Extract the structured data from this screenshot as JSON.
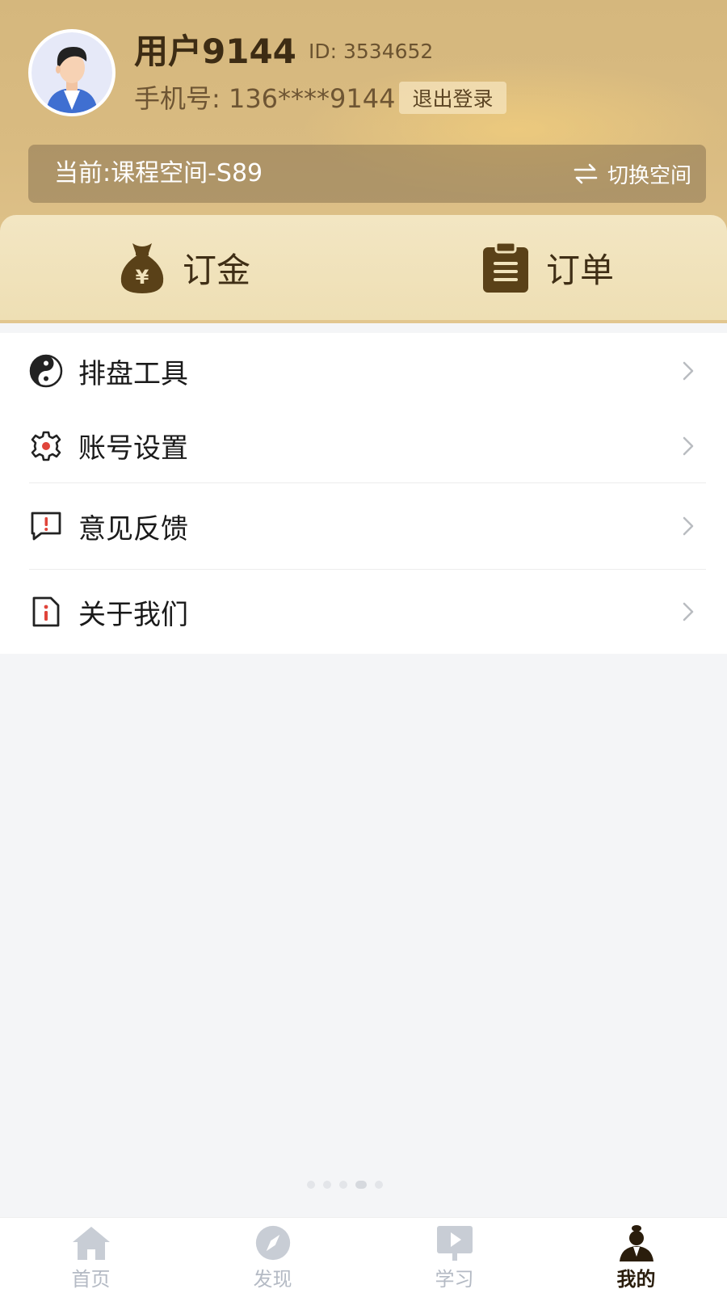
{
  "user": {
    "name": "用户9144",
    "id_text": "ID: 3534652",
    "phone_text": "手机号: 136****9144",
    "logout_label": "退出登录"
  },
  "space": {
    "current_label": "当前:课程空间-S89",
    "switch_label": "切换空间"
  },
  "cards": [
    {
      "label": "订金",
      "icon": "money-bag-icon"
    },
    {
      "label": "订单",
      "icon": "clipboard-icon"
    }
  ],
  "menu": [
    {
      "label": "排盘工具",
      "icon": "yin-yang-icon"
    },
    {
      "label": "账号设置",
      "icon": "gear-icon"
    },
    {
      "label": "意见反馈",
      "icon": "feedback-icon"
    },
    {
      "label": "关于我们",
      "icon": "info-icon"
    }
  ],
  "tabs": [
    {
      "label": "首页",
      "icon": "home-icon",
      "active": false
    },
    {
      "label": "发现",
      "icon": "compass-icon",
      "active": false
    },
    {
      "label": "学习",
      "icon": "play-board-icon",
      "active": false
    },
    {
      "label": "我的",
      "icon": "profile-figure-icon",
      "active": true
    }
  ],
  "colors": {
    "header_gold": "#d7b97f",
    "card_cream": "#f1e3bc",
    "brand_brown": "#5a4118",
    "tab_inactive": "#b4bac4",
    "tab_active": "#2a1d0c"
  }
}
